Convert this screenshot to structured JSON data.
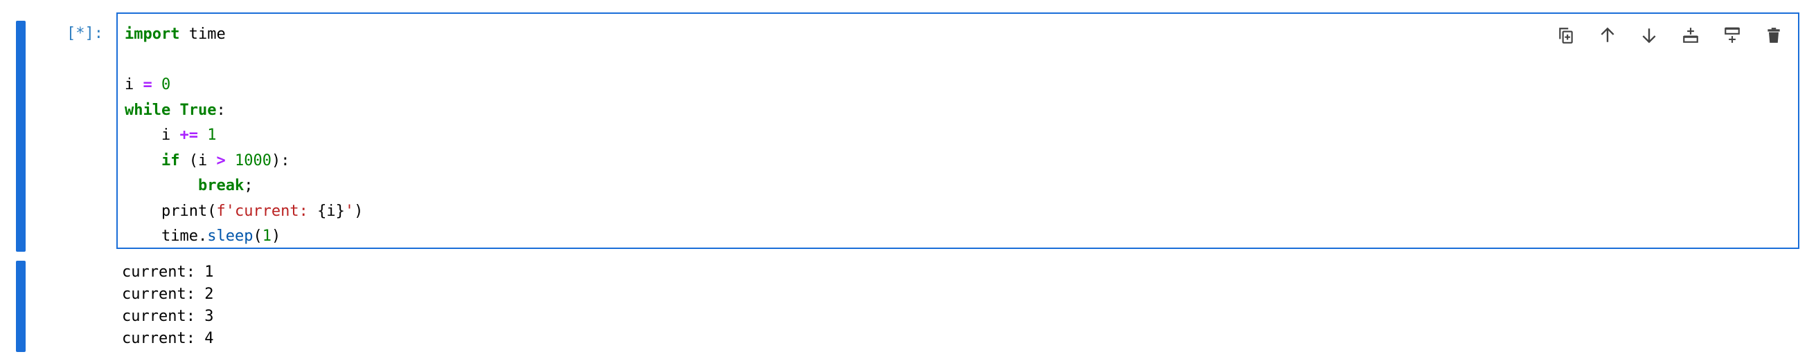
{
  "cell": {
    "prompt": "[*]:",
    "code_tokens": {
      "l1_kw": "import",
      "l1_rest": " time",
      "l3_var": "i ",
      "l3_op": "=",
      "l3_num": " 0",
      "l4_kw_while": "while",
      "l4_kw_true": " True",
      "l4_colon": ":",
      "l5_indent_var": "    i ",
      "l5_op": "+=",
      "l5_num": " 1",
      "l6_indent": "    ",
      "l6_kw_if": "if",
      "l6_open": " (i ",
      "l6_op": ">",
      "l6_num": " 1000",
      "l6_close": "):",
      "l7_indent": "        ",
      "l7_kw_break": "break",
      "l7_semi": ";",
      "l8_print": "    print(",
      "l8_str": "f'current: ",
      "l8_brace": "{i}",
      "l8_str_end": "'",
      "l8_close": ")",
      "l9_time": "    time.",
      "l9_meth": "sleep",
      "l9_args": "(",
      "l9_num": "1",
      "l9_close": ")"
    }
  },
  "toolbar": {
    "icons": [
      "duplicate-icon",
      "move-up-icon",
      "move-down-icon",
      "insert-above-icon",
      "insert-below-icon",
      "delete-icon"
    ],
    "icon_color": "#424242"
  },
  "output": {
    "lines": [
      "current: 1",
      "current: 2",
      "current: 3",
      "current: 4"
    ]
  },
  "colors": {
    "accent": "#1a6ed8",
    "keyword": "#008000",
    "operator": "#aa22ff",
    "string": "#ba2121",
    "prompt": "#307fc1"
  }
}
